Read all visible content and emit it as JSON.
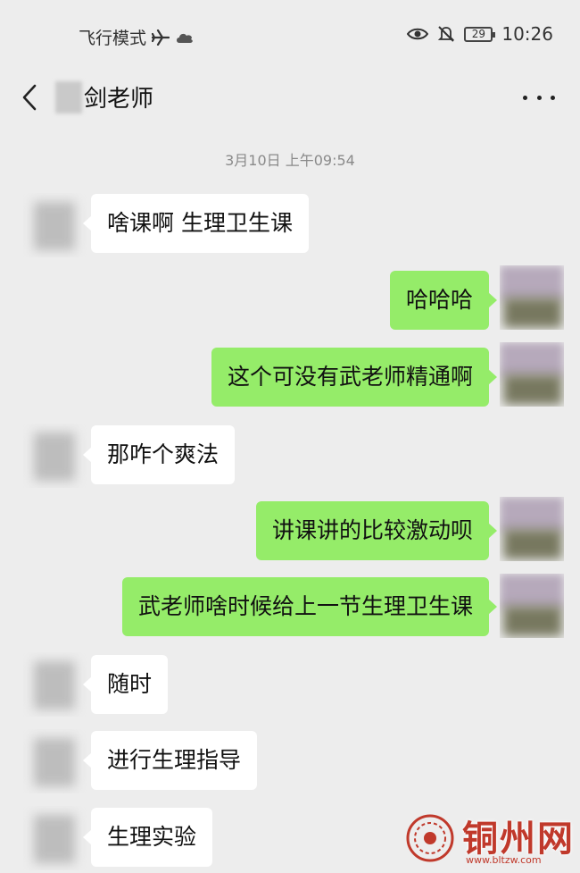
{
  "status_bar": {
    "airplane_mode_label": "飞行模式",
    "time": "10:26",
    "battery_level": "29"
  },
  "header": {
    "title": "剑老师"
  },
  "timestamp": "3月10日 上午09:54",
  "messages": [
    {
      "side": "in",
      "text": "啥课啊 生理卫生课"
    },
    {
      "side": "out",
      "text": "哈哈哈"
    },
    {
      "side": "out",
      "text": "这个可没有武老师精通啊"
    },
    {
      "side": "in",
      "text": "那咋个爽法"
    },
    {
      "side": "out",
      "text": "讲课讲的比较激动呗"
    },
    {
      "side": "out",
      "text": "武老师啥时候给上一节生理卫生课"
    },
    {
      "side": "in",
      "text": "随时"
    },
    {
      "side": "in",
      "text": "进行生理指导"
    },
    {
      "side": "in",
      "text": "生理实验"
    }
  ],
  "watermark": {
    "name": "铜州网",
    "url": "www.bltzw.com"
  },
  "colors": {
    "background": "#ededed",
    "incoming_bubble": "#ffffff",
    "outgoing_bubble": "#95ec69",
    "watermark_red": "#c0392b"
  }
}
